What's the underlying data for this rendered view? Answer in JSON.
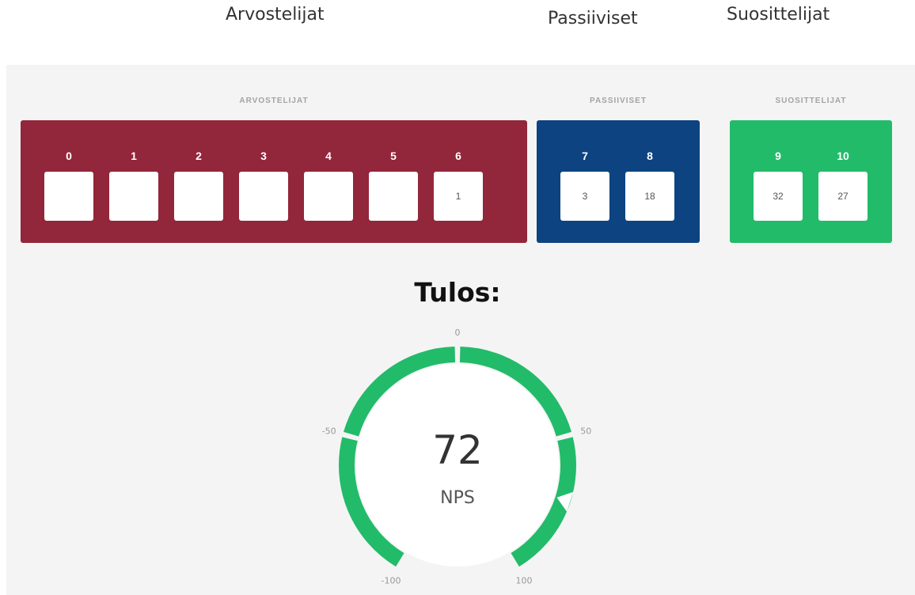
{
  "header": {
    "detractors_label": "Arvostelijat",
    "passives_label": "Passiiviset",
    "promoters_label": "Suosittelijat"
  },
  "groups": {
    "detractors_label": "ARVOSTELIJAT",
    "passives_label": "PASSIIVISET",
    "promoters_label": "SUOSITTELIJAT"
  },
  "scores": {
    "detractors": [
      {
        "score": "0",
        "count": ""
      },
      {
        "score": "1",
        "count": ""
      },
      {
        "score": "2",
        "count": ""
      },
      {
        "score": "3",
        "count": ""
      },
      {
        "score": "4",
        "count": ""
      },
      {
        "score": "5",
        "count": ""
      },
      {
        "score": "6",
        "count": "1"
      }
    ],
    "passives": [
      {
        "score": "7",
        "count": "3"
      },
      {
        "score": "8",
        "count": "18"
      }
    ],
    "promoters": [
      {
        "score": "9",
        "count": "32"
      },
      {
        "score": "10",
        "count": "27"
      }
    ]
  },
  "result": {
    "title": "Tulos:",
    "value": "72",
    "unit": "NPS",
    "score": 72
  },
  "gauge": {
    "ticks": [
      "-100",
      "-50",
      "0",
      "50",
      "100"
    ],
    "arc_color": "#22bb6a",
    "pointer_color": "#ffffff"
  },
  "colors": {
    "detractors": "#92263a",
    "passives": "#0d4380",
    "promoters": "#22bb6a"
  }
}
